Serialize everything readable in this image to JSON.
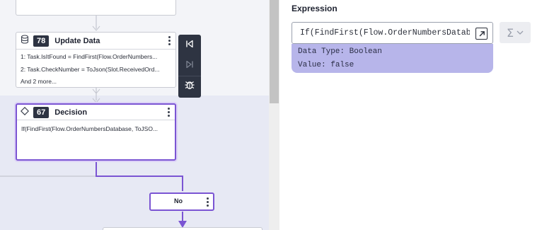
{
  "canvas": {
    "top_node": {},
    "update_node": {
      "number": "78",
      "title": "Update Data",
      "lines": [
        "1: Task.IsItFound = FindFirst(Flow.OrderNumbers...",
        "2: Task.CheckNumber = ToJson(Slot.ReceivedOrd...",
        "And 2 more..."
      ],
      "icon": "database-icon"
    },
    "decision_node": {
      "number": "67",
      "title": "Decision",
      "expression": "If(FindFirst(Flow.OrderNumbersDatabase, ToJSO...",
      "icon": "diamond-icon"
    },
    "no_node": {
      "label": "No"
    },
    "toolbar": {
      "icons": [
        "skip-back-icon",
        "skip-forward-icon",
        "bug-icon"
      ]
    }
  },
  "panel": {
    "title": "Expression",
    "expression_value": "If(FindFirst(Flow.OrderNumbersDatabase, ToJSON(Slot.ReceivedOrderNumber)))",
    "result": {
      "data_type_label": "Data Type:",
      "data_type_value": "Boolean",
      "value_label": "Value:",
      "value_value": "false"
    },
    "sigma_icon": "sigma-icon"
  },
  "colors": {
    "accent": "#7b55d3",
    "result_bg": "#b7b5ea",
    "toolbar_bg": "#2e3442"
  }
}
